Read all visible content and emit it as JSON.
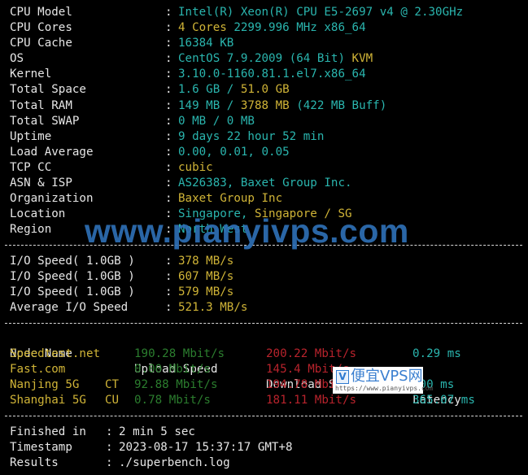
{
  "system_info": [
    {
      "label": "CPU Model",
      "parts": [
        {
          "text": "Intel(R) Xeon(R) CPU E5-2697 v4 @ 2.30GHz",
          "color": "cyan"
        }
      ]
    },
    {
      "label": "CPU Cores",
      "parts": [
        {
          "text": "4 Cores ",
          "color": "yellow"
        },
        {
          "text": "2299.996 MHz x86_64",
          "color": "cyan"
        }
      ]
    },
    {
      "label": "CPU Cache",
      "parts": [
        {
          "text": "16384 KB",
          "color": "cyan"
        }
      ]
    },
    {
      "label": "OS",
      "parts": [
        {
          "text": "CentOS 7.9.2009 (64 Bit) ",
          "color": "cyan"
        },
        {
          "text": "KVM",
          "color": "yellow"
        }
      ]
    },
    {
      "label": "Kernel",
      "parts": [
        {
          "text": "3.10.0-1160.81.1.el7.x86_64",
          "color": "cyan"
        }
      ]
    },
    {
      "label": "Total Space",
      "parts": [
        {
          "text": "1.6 GB / ",
          "color": "cyan"
        },
        {
          "text": "51.0 GB",
          "color": "yellow"
        }
      ]
    },
    {
      "label": "Total RAM",
      "parts": [
        {
          "text": "149 MB / ",
          "color": "cyan"
        },
        {
          "text": "3788 MB",
          "color": "yellow"
        },
        {
          "text": " (422 MB Buff)",
          "color": "cyan"
        }
      ]
    },
    {
      "label": "Total SWAP",
      "parts": [
        {
          "text": "0 MB / 0 MB",
          "color": "cyan"
        }
      ]
    },
    {
      "label": "Uptime",
      "parts": [
        {
          "text": "9 days 22 hour 52 min",
          "color": "cyan"
        }
      ]
    },
    {
      "label": "Load Average",
      "parts": [
        {
          "text": "0.00, 0.01, 0.05",
          "color": "cyan"
        }
      ]
    },
    {
      "label": "TCP CC",
      "parts": [
        {
          "text": "cubic",
          "color": "yellow"
        }
      ]
    },
    {
      "label": "ASN & ISP",
      "parts": [
        {
          "text": "AS26383, Baxet Group Inc.",
          "color": "cyan"
        }
      ]
    },
    {
      "label": "Organization",
      "parts": [
        {
          "text": "Baxet Group Inc",
          "color": "yellow"
        }
      ]
    },
    {
      "label": "Location",
      "parts": [
        {
          "text": "Singapore, ",
          "color": "cyan"
        },
        {
          "text": "Singapore / SG",
          "color": "yellow"
        }
      ]
    },
    {
      "label": "Region",
      "parts": [
        {
          "text": "North West",
          "color": "cyan"
        }
      ]
    }
  ],
  "separator_char": ":",
  "io": [
    {
      "label": "I/O Speed( 1.0GB )",
      "value": "378 MB/s"
    },
    {
      "label": "I/O Speed( 1.0GB )",
      "value": "607 MB/s"
    },
    {
      "label": "I/O Speed( 1.0GB )",
      "value": "579 MB/s"
    },
    {
      "label": "Average I/O Speed",
      "value": "521.3 MB/s"
    }
  ],
  "speed_table": {
    "headers": [
      "Node Name",
      "Upload Speed",
      "Download Speed",
      "Latency"
    ],
    "rows": [
      {
        "node": "Speedtest.net",
        "tag": "",
        "upload": "190.28 Mbit/s",
        "download": "200.22 Mbit/s",
        "latency": "0.29 ms"
      },
      {
        "node": "Fast.com",
        "tag": "",
        "upload": "0.00 Mbit/s",
        "download": "145.4 Mbit/s",
        "latency": ""
      },
      {
        "node": "Nanjing 5G",
        "tag": "CT",
        "upload": "92.88 Mbit/s",
        "download": "194.78 Mbit/s",
        "latency": "…00 ms"
      },
      {
        "node": "Shanghai 5G",
        "tag": "CU",
        "upload": "0.78 Mbit/s",
        "download": "181.11 Mbit/s",
        "latency": "365.07 ms"
      }
    ]
  },
  "summary": [
    {
      "label": "Finished in",
      "value": "2 min 5 sec"
    },
    {
      "label": "Timestamp",
      "value": "2023-08-17 15:37:17 GMT+8"
    },
    {
      "label": "Results",
      "value": "./superbench.log"
    }
  ],
  "watermarks": {
    "big": "www.pianyivps.com",
    "logo_letter": "V",
    "logo_cn": "便宜VPS网",
    "logo_url": "https://www.pianyivps.com"
  },
  "colors": {
    "cyan": "#2ab5ae",
    "yellow": "#d0b437",
    "green": "#2b7d2e",
    "red": "#b8232c",
    "white": "#e6e6e6",
    "background": "#000000"
  }
}
